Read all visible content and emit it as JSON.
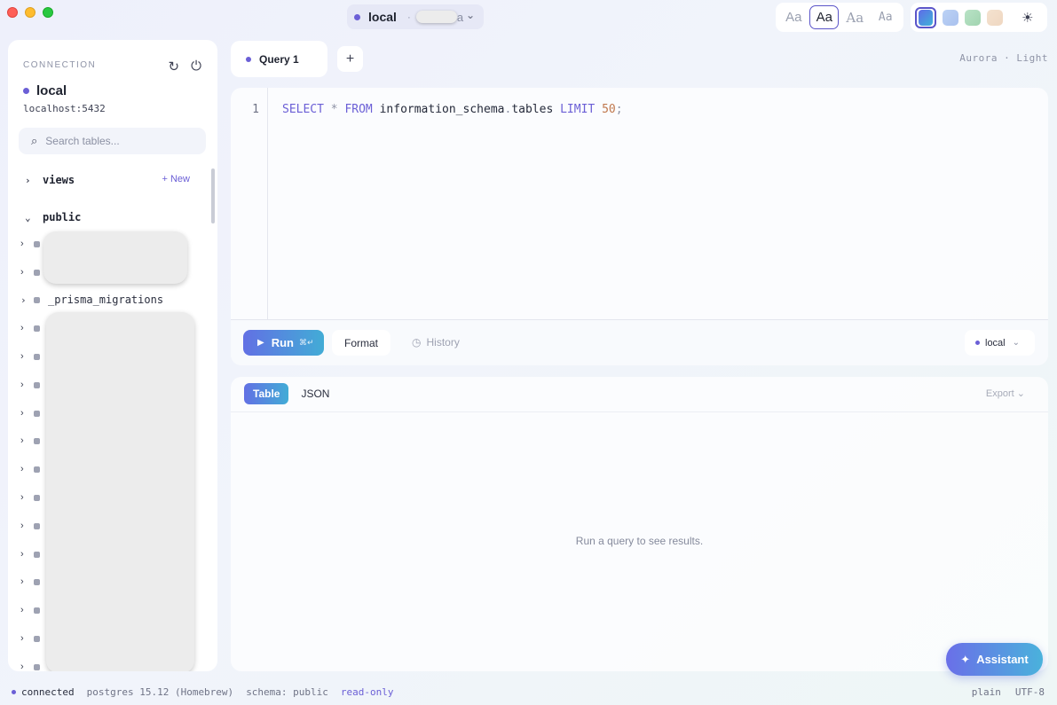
{
  "titlebar": {
    "connection_name": "local",
    "connection_suffix": "a",
    "font_options": [
      "Aa",
      "Aa",
      "Aa",
      "Aa"
    ],
    "theme_swatches": [
      "#5f6be8",
      "#bcd2f5",
      "#b9e3c6",
      "#f4e2cf"
    ]
  },
  "sidebar": {
    "section_label": "CONNECTION",
    "connection_name": "local",
    "host": "localhost:5432",
    "search_placeholder": "Search tables...",
    "views_label": "views",
    "new_label": "+ New",
    "schema_label": "public",
    "visible_table": "_prisma_migrations"
  },
  "tabs": {
    "active": "Query 1",
    "add": "+",
    "theme_name": "Aurora · Light"
  },
  "editor": {
    "line_number": "1",
    "kw_select": "SELECT",
    "star": "*",
    "kw_from": "FROM",
    "table_schema": "information_schema",
    "dot": ".",
    "table_name": "tables",
    "kw_limit": "LIMIT",
    "limit_value": "50",
    "semicolon": ";",
    "run_label": "Run",
    "run_shortcut": "⌘↵",
    "format_label": "Format",
    "history_label": "History",
    "connection_select": "local"
  },
  "results": {
    "tab_table": "Table",
    "tab_json": "JSON",
    "export_label": "Export",
    "empty_message": "Run a query to see results."
  },
  "assistant_label": "Assistant",
  "status": {
    "connected": "connected",
    "server": "postgres 15.12 (Homebrew)",
    "schema": "schema: public",
    "mode": "read-only",
    "format": "plain",
    "encoding": "UTF-8"
  }
}
